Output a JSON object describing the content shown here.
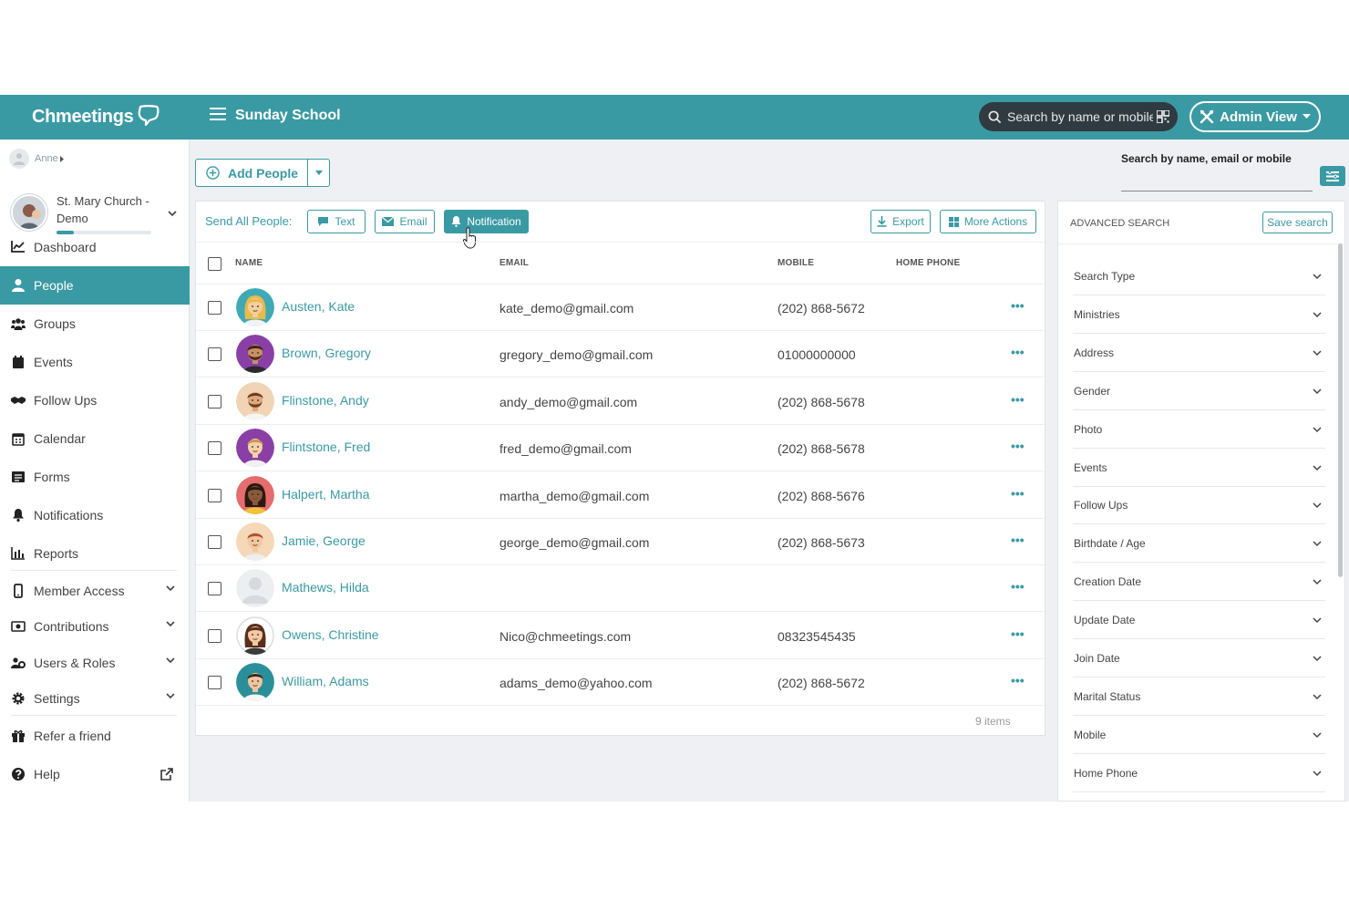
{
  "app": {
    "logo": "Chmeetings",
    "page_title": "Sunday School",
    "accent": "#3a9aa3"
  },
  "topbar": {
    "search_placeholder": "Search by name or mobile",
    "admin_view_label": "Admin View"
  },
  "sidebar": {
    "user": "Anne",
    "church_name": "St. Mary Church - Demo",
    "church_progress": 0.18,
    "items": [
      {
        "label": "Dashboard",
        "icon": "chart-icon"
      },
      {
        "label": "People",
        "icon": "person-icon",
        "active": true
      },
      {
        "label": "Groups",
        "icon": "group-icon"
      },
      {
        "label": "Events",
        "icon": "event-icon"
      },
      {
        "label": "Follow Ups",
        "icon": "handshake-icon"
      },
      {
        "label": "Calendar",
        "icon": "calendar-icon"
      },
      {
        "label": "Forms",
        "icon": "form-icon"
      },
      {
        "label": "Notifications",
        "icon": "bell-icon"
      },
      {
        "label": "Reports",
        "icon": "bar-chart-icon"
      },
      {
        "label": "Member Access",
        "icon": "mobile-icon",
        "expandable": true
      },
      {
        "label": "Contributions",
        "icon": "money-icon",
        "expandable": true
      },
      {
        "label": "Users & Roles",
        "icon": "users-cog-icon",
        "expandable": true
      },
      {
        "label": "Settings",
        "icon": "gear-icon",
        "expandable": true
      },
      {
        "label": "Refer a friend",
        "icon": "gift-icon"
      },
      {
        "label": "Help",
        "icon": "help-icon",
        "external": true
      }
    ]
  },
  "toolbar": {
    "add_people_label": "Add People",
    "send_all_label": "Send All People:",
    "text_label": "Text",
    "email_label": "Email",
    "notification_label": "Notification",
    "export_label": "Export",
    "more_actions_label": "More Actions"
  },
  "table": {
    "columns": {
      "name": "NAME",
      "email": "EMAIL",
      "mobile": "MOBILE",
      "home_phone": "HOME PHONE"
    },
    "rows": [
      {
        "name": "Austen, Kate",
        "email": "kate_demo@gmail.com",
        "mobile": "(202) 868-5672",
        "home_phone": ""
      },
      {
        "name": "Brown, Gregory",
        "email": "gregory_demo@gmail.com",
        "mobile": "01000000000",
        "home_phone": ""
      },
      {
        "name": "Flinstone, Andy",
        "email": "andy_demo@gmail.com",
        "mobile": "(202) 868-5678",
        "home_phone": ""
      },
      {
        "name": "Flintstone, Fred",
        "email": "fred_demo@gmail.com",
        "mobile": "(202) 868-5678",
        "home_phone": ""
      },
      {
        "name": "Halpert, Martha",
        "email": "martha_demo@gmail.com",
        "mobile": "(202) 868-5676",
        "home_phone": ""
      },
      {
        "name": "Jamie, George",
        "email": "george_demo@gmail.com",
        "mobile": "(202) 868-5673",
        "home_phone": ""
      },
      {
        "name": "Mathews, Hilda",
        "email": "",
        "mobile": "",
        "home_phone": ""
      },
      {
        "name": "Owens, Christine",
        "email": "Nico@chmeetings.com",
        "mobile": "08323545435",
        "home_phone": ""
      },
      {
        "name": "William, Adams",
        "email": "adams_demo@yahoo.com",
        "mobile": "(202) 868-5672",
        "home_phone": ""
      }
    ],
    "footer": "9 items"
  },
  "advanced_search": {
    "search_label": "Search by name, email or mobile",
    "title": "ADVANCED SEARCH",
    "save_label": "Save search",
    "filters": [
      "Search Type",
      "Ministries",
      "Address",
      "Gender",
      "Photo",
      "Events",
      "Follow Ups",
      "Birthdate / Age",
      "Creation Date",
      "Update Date",
      "Join Date",
      "Marital Status",
      "Mobile",
      "Home Phone"
    ]
  }
}
